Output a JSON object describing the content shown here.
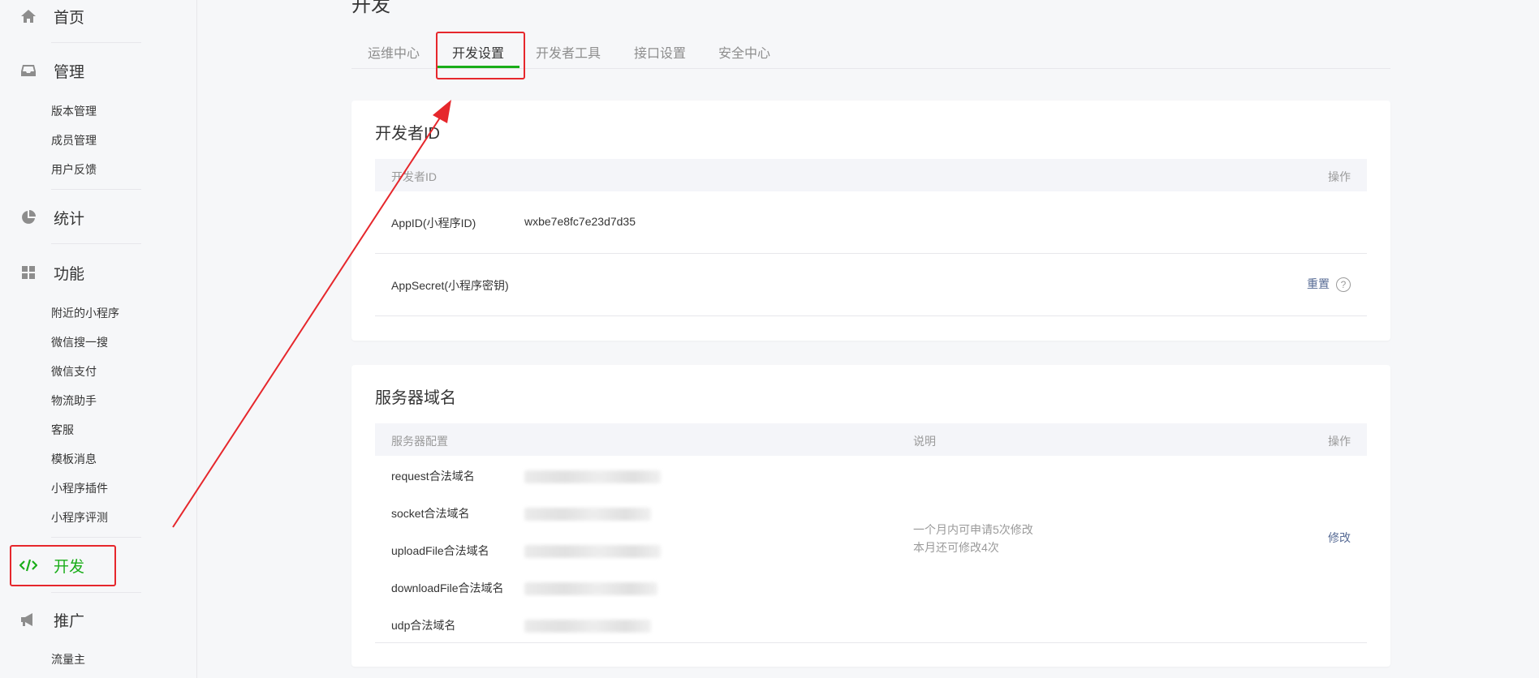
{
  "sidebar": {
    "home": "首页",
    "manage": "管理",
    "manage_items": [
      "版本管理",
      "成员管理",
      "用户反馈"
    ],
    "stats": "统计",
    "features": "功能",
    "feature_items": [
      "附近的小程序",
      "微信搜一搜",
      "微信支付",
      "物流助手",
      "客服",
      "模板消息",
      "小程序插件",
      "小程序评测"
    ],
    "develop": "开发",
    "promote": "推广",
    "promote_items": [
      "流量主"
    ]
  },
  "main": {
    "title": "开发",
    "tabs": [
      "运维中心",
      "开发设置",
      "开发者工具",
      "接口设置",
      "安全中心"
    ],
    "active_tab": "开发设置"
  },
  "developer_id": {
    "title": "开发者ID",
    "col_id": "开发者ID",
    "col_action": "操作",
    "appid_label": "AppID(小程序ID)",
    "appid_value": "wxbe7e8fc7e23d7d35",
    "secret_label": "AppSecret(小程序密钥)",
    "reset_label": "重置",
    "help_glyph": "?"
  },
  "server_domain": {
    "title": "服务器域名",
    "col_config": "服务器配置",
    "col_desc": "说明",
    "col_action": "操作",
    "rows": [
      "request合法域名",
      "socket合法域名",
      "uploadFile合法域名",
      "downloadFile合法域名",
      "udp合法域名"
    ],
    "desc_line1": "一个月内可申请5次修改",
    "desc_line2": "本月还可修改4次",
    "modify_label": "修改"
  },
  "colors": {
    "accent": "#1aad19",
    "highlight": "#e6272c",
    "link": "#576b95"
  }
}
